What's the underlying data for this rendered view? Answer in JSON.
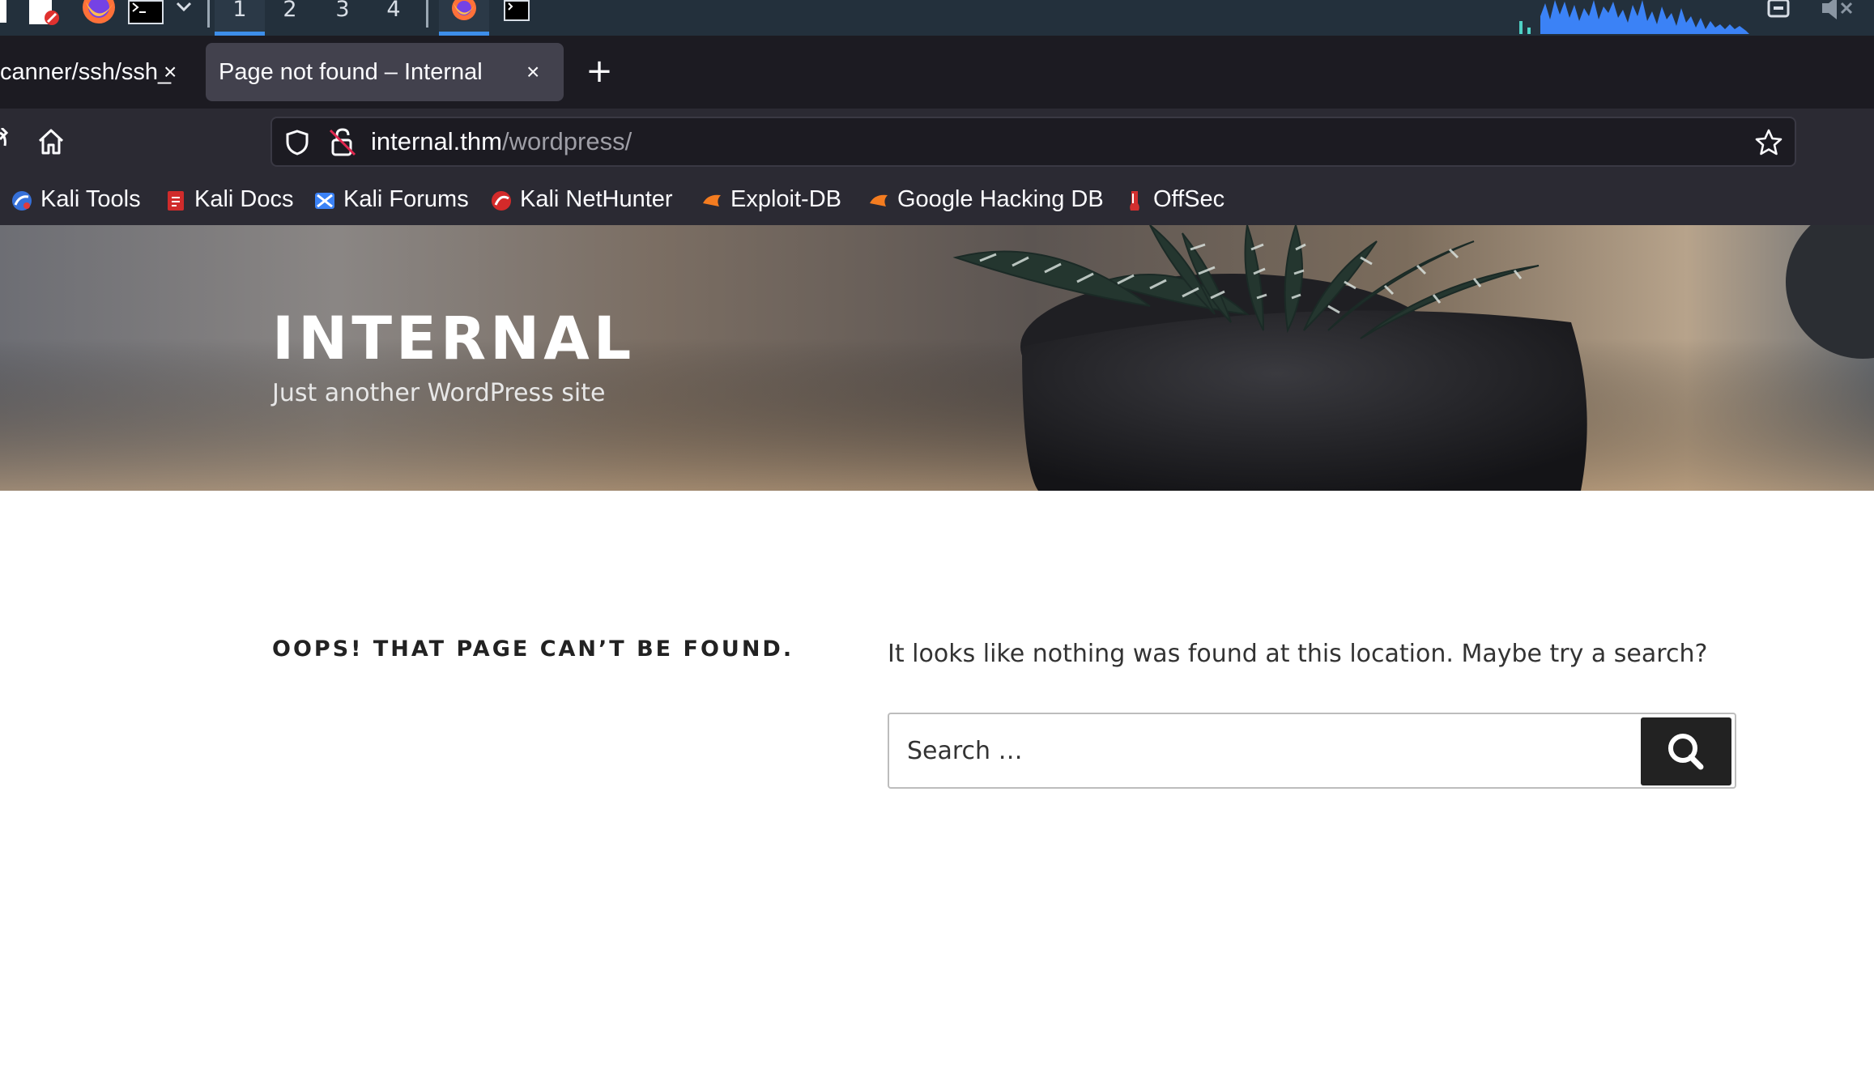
{
  "os_panel": {
    "workspaces": [
      "1",
      "2",
      "3",
      "4"
    ],
    "active_workspace": "1",
    "icons": [
      "app-launcher-icon",
      "text-editor-icon",
      "firefox-icon",
      "terminal-icon",
      "dropdown-chevron-icon",
      "firefox-window-icon",
      "terminal-window-icon",
      "cpu-monitor-graph",
      "clipboard-icon",
      "volume-muted-icon"
    ]
  },
  "browser": {
    "tabs": [
      {
        "label": "canner/ssh/ssh_",
        "active": false
      },
      {
        "label": "Page not found – Internal",
        "active": true
      }
    ],
    "new_tab_symbol": "+",
    "url": {
      "host": "internal.thm",
      "path": "/wordpress/"
    },
    "bookmarks": [
      {
        "label": "Kali Tools",
        "icon": "kali-tools-icon"
      },
      {
        "label": "Kali Docs",
        "icon": "kali-docs-icon"
      },
      {
        "label": "Kali Forums",
        "icon": "kali-forums-icon"
      },
      {
        "label": "Kali NetHunter",
        "icon": "kali-nethunter-icon"
      },
      {
        "label": "Exploit-DB",
        "icon": "exploit-db-icon"
      },
      {
        "label": "Google Hacking DB",
        "icon": "google-hacking-db-icon"
      },
      {
        "label": "OffSec",
        "icon": "offsec-icon"
      }
    ]
  },
  "site": {
    "title": "INTERNAL",
    "description": "Just another WordPress site"
  },
  "content": {
    "error_title": "OOPS! THAT PAGE CAN’T BE FOUND.",
    "message": "It looks like nothing was found at this location. Maybe try a search?",
    "search_placeholder": "Search …"
  },
  "colors": {
    "panel_bg": "#23303c",
    "active_accent": "#3d8eea",
    "browser_chrome": "#2b2a33",
    "tab_strip": "#1c1b22",
    "search_button": "#222222"
  }
}
